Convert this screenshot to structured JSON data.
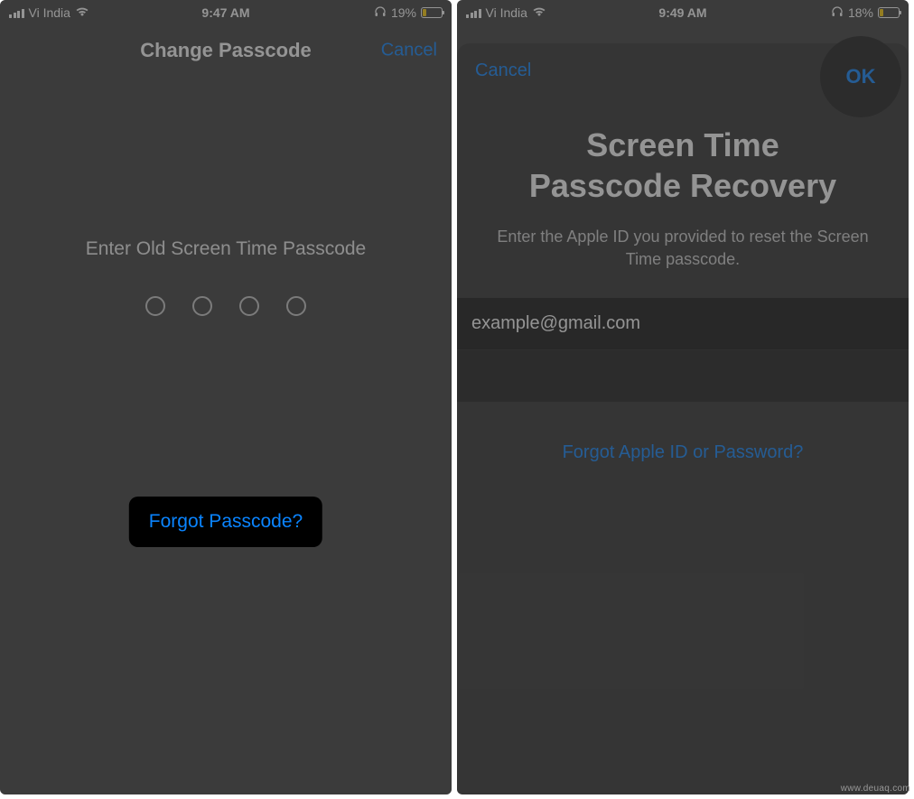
{
  "phone1": {
    "status": {
      "carrier": "Vi India",
      "time": "9:47 AM",
      "battery_pct": "19%"
    },
    "nav": {
      "title": "Change Passcode",
      "cancel": "Cancel"
    },
    "prompt": "Enter Old Screen Time Passcode",
    "forgot": "Forgot Passcode?"
  },
  "phone2": {
    "status": {
      "carrier": "Vi India",
      "time": "9:49 AM",
      "battery_pct": "18%"
    },
    "sheet": {
      "cancel": "Cancel",
      "ok": "OK",
      "title_line1": "Screen Time",
      "title_line2": "Passcode Recovery",
      "subtitle": "Enter the Apple ID you provided to reset the Screen Time passcode.",
      "email_value": "example@gmail.com",
      "forgot_link": "Forgot Apple ID or Password?"
    }
  },
  "watermark": "www.deuaq.com"
}
